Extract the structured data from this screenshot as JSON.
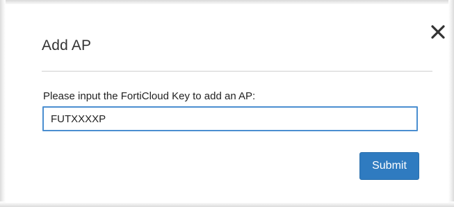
{
  "dialog": {
    "title": "Add AP",
    "close_icon": "close-icon",
    "prompt_label": "Please input the FortiCloud Key to add an AP:",
    "key_value": "FUTXXXXP",
    "submit_label": "Submit"
  },
  "colors": {
    "input_border": "#4a8ed0",
    "button_bg": "#2f7bc0",
    "button_text": "#ffffff",
    "title_text": "#333333"
  }
}
